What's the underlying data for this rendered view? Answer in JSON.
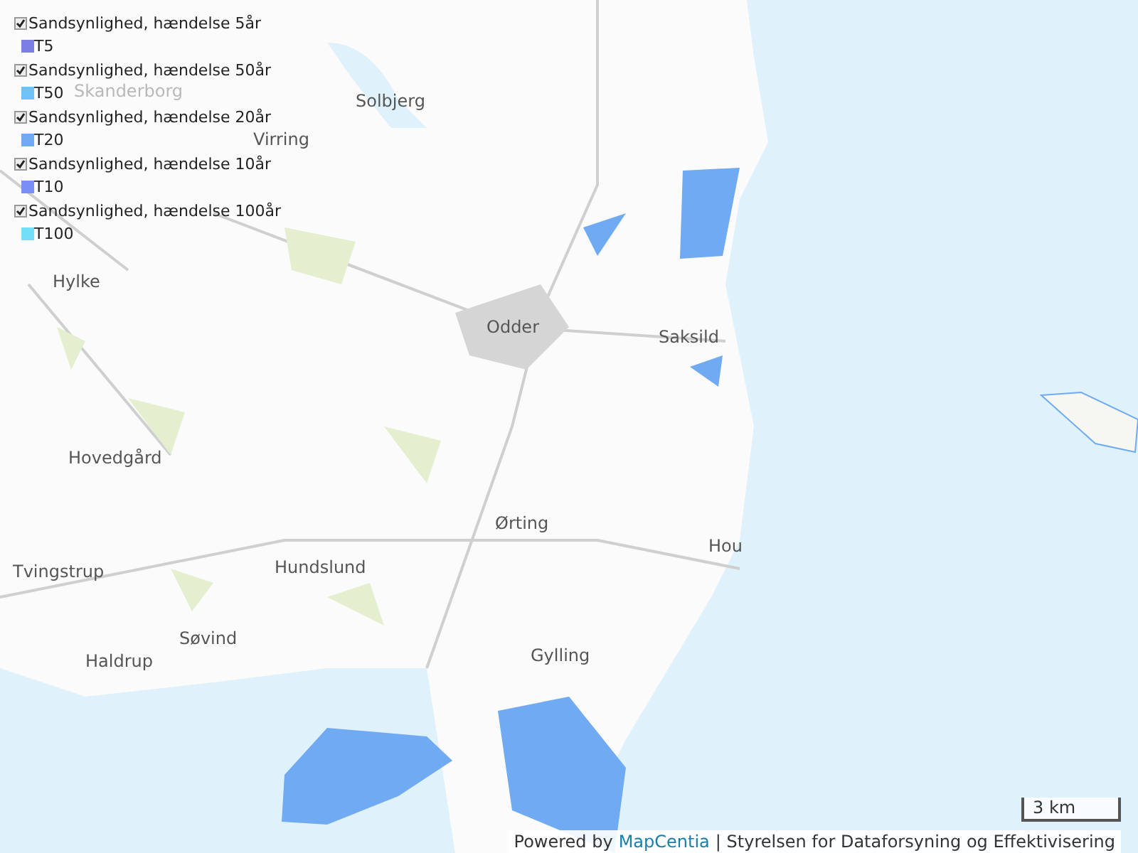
{
  "legend": [
    {
      "label": "Sandsynlighed, hændelse 5år",
      "checked": true,
      "code": "T5",
      "color": "#7b7fe3"
    },
    {
      "label": "Sandsynlighed, hændelse 50år",
      "checked": true,
      "code": "T50",
      "color": "#6cc3f7"
    },
    {
      "label": "Sandsynlighed, hændelse 20år",
      "checked": true,
      "code": "T20",
      "color": "#6faaf2"
    },
    {
      "label": "Sandsynlighed, hændelse 10år",
      "checked": true,
      "code": "T10",
      "color": "#7a8ef7"
    },
    {
      "label": "Sandsynlighed, hændelse 100år",
      "checked": true,
      "code": "T100",
      "color": "#72def7"
    }
  ],
  "places": [
    {
      "name": "Skanderborg",
      "faded": true
    },
    {
      "name": "Solbjerg",
      "faded": false
    },
    {
      "name": "Virring",
      "faded": false
    },
    {
      "name": "Hylke",
      "faded": false
    },
    {
      "name": "Odder",
      "faded": false
    },
    {
      "name": "Saksild",
      "faded": false
    },
    {
      "name": "Hovedgård",
      "faded": false
    },
    {
      "name": "Ørting",
      "faded": false
    },
    {
      "name": "Hou",
      "faded": false
    },
    {
      "name": "Tvingstrup",
      "faded": false
    },
    {
      "name": "Hundslund",
      "faded": false
    },
    {
      "name": "Søvind",
      "faded": false
    },
    {
      "name": "Gylling",
      "faded": false
    },
    {
      "name": "Haldrup",
      "faded": false
    }
  ],
  "scale": "3 km",
  "attribution": {
    "prefix": "Powered by",
    "link": "MapCentia",
    "suffix": "| Styrelsen for Dataforsyning og Effektivisering"
  }
}
